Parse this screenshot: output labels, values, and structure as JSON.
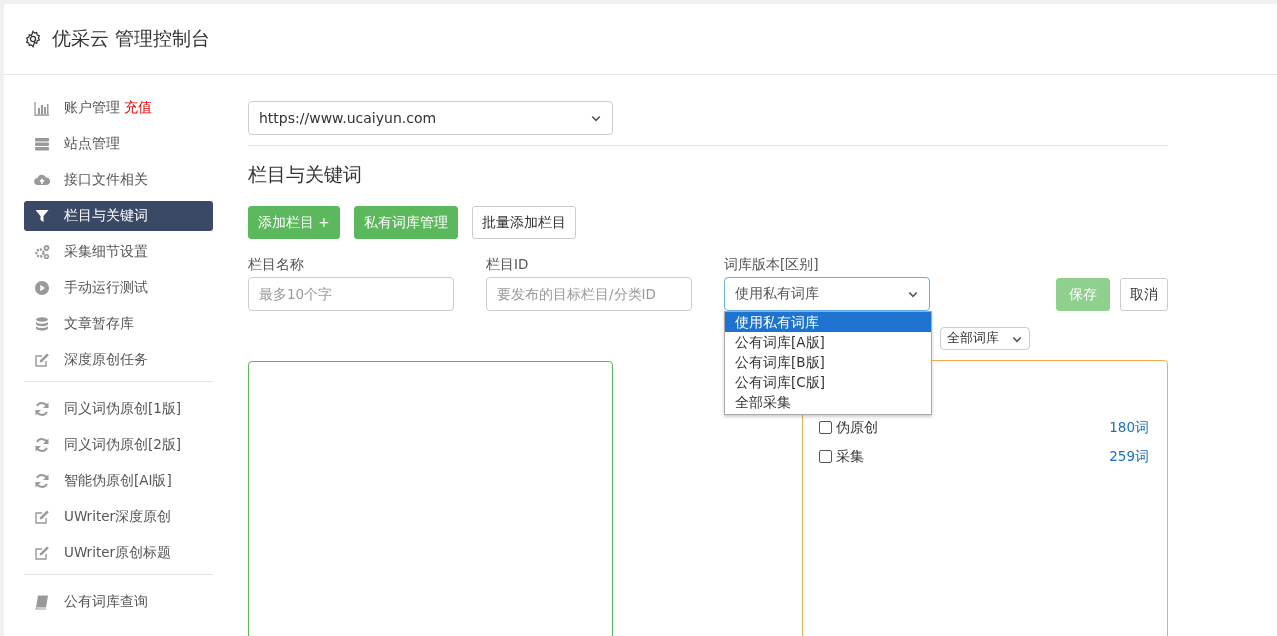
{
  "header": {
    "title": "优采云 管理控制台"
  },
  "sidebar": {
    "groups": [
      {
        "items": [
          {
            "label": "账户管理",
            "badge": "充值",
            "selected": false
          },
          {
            "label": "站点管理",
            "selected": false
          },
          {
            "label": "接口文件相关",
            "selected": false
          },
          {
            "label": "栏目与关键词",
            "selected": true
          },
          {
            "label": "采集细节设置",
            "selected": false
          },
          {
            "label": "手动运行测试",
            "selected": false
          },
          {
            "label": "文章暂存库",
            "selected": false
          },
          {
            "label": "深度原创任务",
            "selected": false
          }
        ]
      },
      {
        "items": [
          {
            "label": "同义词伪原创[1版]",
            "selected": false
          },
          {
            "label": "同义词伪原创[2版]",
            "selected": false
          },
          {
            "label": "智能伪原创[AI版]",
            "selected": false
          },
          {
            "label": "UWriter深度原创",
            "selected": false
          },
          {
            "label": "UWriter原创标题",
            "selected": false
          }
        ]
      },
      {
        "items": [
          {
            "label": "公有词库查询",
            "selected": false
          }
        ]
      }
    ]
  },
  "site_select": {
    "value": "https://www.ucaiyun.com"
  },
  "section_title": "栏目与关键词",
  "toolbar": [
    {
      "label": "添加栏目 +",
      "kind": "primary"
    },
    {
      "label": "私有词库管理",
      "kind": "primary"
    },
    {
      "label": "批量添加栏目",
      "kind": "default"
    }
  ],
  "form": {
    "name_field": {
      "label": "栏目名称",
      "placeholder": "最多10个字"
    },
    "id_field": {
      "label": "栏目ID",
      "placeholder": "要发布的目标栏目/分类ID"
    },
    "library_select": {
      "label": "词库版本[区别]",
      "value": "使用私有词库",
      "options": [
        {
          "label": "使用私有词库",
          "selected": true
        },
        {
          "label": "公有词库[A版]",
          "selected": false
        },
        {
          "label": "公有词库[B版]",
          "selected": false
        },
        {
          "label": "公有词库[C版]",
          "selected": false
        },
        {
          "label": "全部采集",
          "selected": false
        }
      ]
    },
    "save_button": "保存",
    "cancel_button": "取消"
  },
  "library_filter": {
    "value": "全部词库"
  },
  "library_list": [
    {
      "label": "伪原创",
      "count": "180词",
      "checked": false
    },
    {
      "label": "采集",
      "count": "259词",
      "checked": false
    }
  ]
}
